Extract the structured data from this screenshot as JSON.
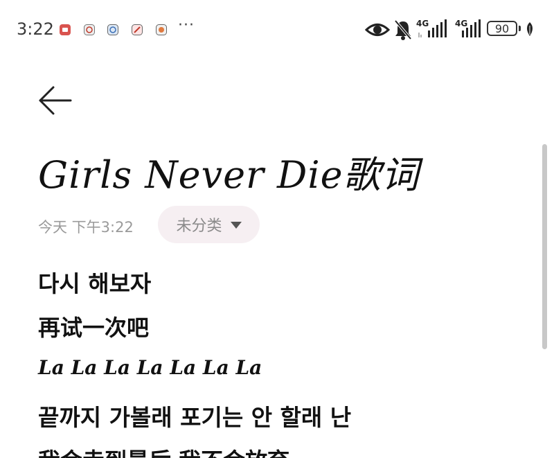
{
  "status_bar": {
    "time": "3:22",
    "notification_icons": [
      "app-notification-icon",
      "app-notification-icon",
      "app-notification-icon",
      "app-notification-icon",
      "app-notification-icon"
    ],
    "more_indicator": "···",
    "network_1": "4G",
    "network_2": "4G",
    "battery_level": "90",
    "icons": [
      "eye-icon",
      "bell-muted-icon",
      "signal-icon",
      "signal-icon",
      "battery-icon",
      "leaf-icon"
    ]
  },
  "header": {
    "back_icon": "back-arrow-icon"
  },
  "note": {
    "title": "Girls Never Die歌词",
    "date": "今天 下午3:22",
    "category": "未分类",
    "lines": [
      "다시 해보자",
      "再试一次吧",
      "La La La La La La La",
      "끝까지 가볼래 포기는 안 할래 난",
      "我会走到最后 我不会放弃"
    ]
  },
  "colors": {
    "background": "#ffffff",
    "chip_background": "#f6eff2",
    "meta_text": "#9a9a9a",
    "body_text": "#111111",
    "scrollbar": "#c8c8c8"
  }
}
